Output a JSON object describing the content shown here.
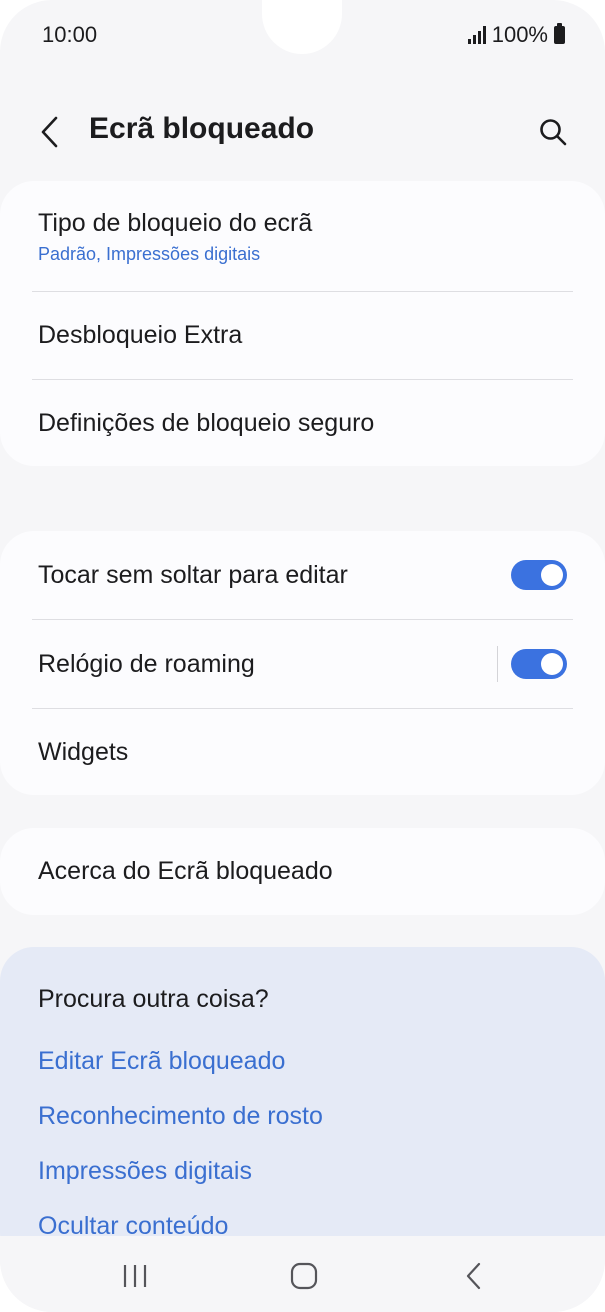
{
  "status_bar": {
    "time": "10:00",
    "battery": "100%"
  },
  "header": {
    "title": "Ecrã bloqueado"
  },
  "section1": {
    "items": [
      {
        "title": "Tipo de bloqueio do ecrã",
        "subtitle": "Padrão, Impressões digitais"
      },
      {
        "title": "Desbloqueio Extra"
      },
      {
        "title": "Definições de bloqueio seguro"
      }
    ]
  },
  "section2": {
    "items": [
      {
        "title": "Tocar sem soltar para editar",
        "toggle": true
      },
      {
        "title": "Relógio de roaming",
        "toggle": true
      },
      {
        "title": "Widgets"
      }
    ]
  },
  "section3": {
    "items": [
      {
        "title": "Acerca do Ecrã bloqueado"
      }
    ]
  },
  "suggestions": {
    "title": "Procura outra coisa?",
    "links": [
      "Editar Ecrã bloqueado",
      "Reconhecimento de rosto",
      "Impressões digitais",
      "Ocultar conteúdo"
    ]
  },
  "colors": {
    "accent": "#3b72e0",
    "link": "#3a6fd0",
    "background": "#f6f6f8",
    "card": "#fcfcfe",
    "suggest_card": "#e5eaf6"
  },
  "icons": {
    "back": "chevron-left-icon",
    "search": "search-icon",
    "recents": "recents-icon",
    "home": "home-icon",
    "nav_back": "nav-back-icon"
  }
}
